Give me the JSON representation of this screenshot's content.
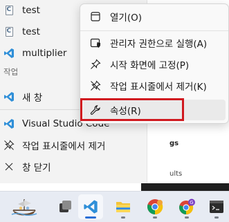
{
  "jumplist": {
    "recent_items": [
      {
        "label": "test",
        "icon": "c-file-icon"
      },
      {
        "label": "test",
        "icon": "c-file-icon"
      },
      {
        "label": "multiplier",
        "icon": "vscode-icon"
      }
    ],
    "tasks_header": "작업",
    "tasks": [
      {
        "label": "새 창",
        "icon": "vscode-icon"
      }
    ],
    "app_items": [
      {
        "label": "Visual Studio Code",
        "icon": "vscode-icon"
      },
      {
        "label": "작업 표시줄에서 제거",
        "icon": "unpin-icon"
      },
      {
        "label": "창 닫기",
        "icon": "close-icon"
      }
    ]
  },
  "context_menu": {
    "items": [
      {
        "label": "열기(O)",
        "icon": "window-icon"
      },
      {
        "label": "관리자 권한으로 실행(A)",
        "icon": "admin-shield-icon"
      },
      {
        "label": "시작 화면에 고정(P)",
        "icon": "pin-icon"
      },
      {
        "label": "작업 표시줄에서 제거(K)",
        "icon": "unpin-icon"
      },
      {
        "label": "속성(R)",
        "icon": "wrench-icon"
      }
    ],
    "highlighted_item": "속성(R)"
  },
  "background_window": {
    "peek_texts": [
      "gs",
      "ults"
    ]
  },
  "taskbar": {
    "apps": [
      {
        "name": "pirate-ship-app-icon"
      },
      {
        "name": "task-view-icon"
      },
      {
        "name": "vscode-icon",
        "active": true
      },
      {
        "name": "file-explorer-icon"
      },
      {
        "name": "chrome-icon"
      },
      {
        "name": "chrome-profile-g-icon",
        "badge": "G"
      },
      {
        "name": "terminal-icon"
      }
    ]
  },
  "colors": {
    "vscode_blue": "#2f8fd8",
    "highlight_red": "#d0191f",
    "taskbar_bg": "#e7ebf3",
    "menu_bg": "#f9f9f9",
    "jumplist_bg": "#f3f3f3"
  }
}
